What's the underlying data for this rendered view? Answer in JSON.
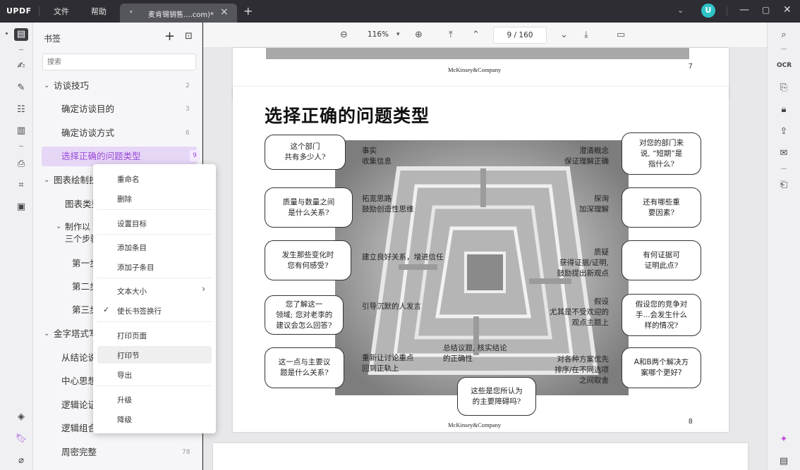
{
  "titlebar": {
    "logo": "UPDF",
    "menus": [
      "文件",
      "帮助"
    ],
    "tab_title": "麦肯锡销售....com)*",
    "tab_close": "×",
    "new_tab": "+",
    "avatar_letter": "U",
    "window_controls": [
      "—",
      "▢",
      "✕"
    ]
  },
  "panel": {
    "title": "书签",
    "search_placeholder": "搜索",
    "items": [
      {
        "label": "访谈技巧",
        "num": "2",
        "level": 0,
        "expanded": true
      },
      {
        "label": "确定访谈目的",
        "num": "3",
        "level": 1
      },
      {
        "label": "确定访谈方式",
        "num": "6",
        "level": 1
      },
      {
        "label": "选择正确的问题类型",
        "num": "9",
        "level": 1,
        "selected": true
      },
      {
        "label": "图表绘制技",
        "num": "",
        "level": 0,
        "expanded": true
      },
      {
        "label": "图表类型",
        "num": "",
        "level": 1
      },
      {
        "label": "制作以",
        "num": "",
        "level": 1,
        "expanded": true
      },
      {
        "label": "三个步骤",
        "num": "",
        "level": 1
      },
      {
        "label": "第一步",
        "num": "",
        "level": 2
      },
      {
        "label": "第二步",
        "num": "",
        "level": 2
      },
      {
        "label": "第三步",
        "num": "",
        "level": 2
      },
      {
        "label": "金字塔式写",
        "num": "",
        "level": 0,
        "expanded": true
      },
      {
        "label": "从结论说",
        "num": "",
        "level": 1
      },
      {
        "label": "中心思想",
        "num": "",
        "level": 1
      },
      {
        "label": "逻辑论证",
        "num": "",
        "level": 1
      },
      {
        "label": "逻辑组合",
        "num": "",
        "level": 1
      },
      {
        "label": "周密完整",
        "num": "78",
        "level": 1
      }
    ]
  },
  "context_menu": {
    "items": [
      "重命名",
      "删除",
      "设置目标",
      "添加条目",
      "添加子条目",
      "文本大小",
      "使长书签换行",
      "打印页面",
      "打印节",
      "导出",
      "升级",
      "降级"
    ]
  },
  "toolbar": {
    "zoom": "116%",
    "page_current": "9",
    "page_total": "160",
    "page_display": "9 / 160"
  },
  "pages": {
    "brand": "McKinsey&Company",
    "prev_num": "7",
    "cur_num": "8",
    "slide_title": "选择正确的问题类型",
    "bubbles_left": [
      "这个部门\n共有多少人?",
      "质量与数量之间\n是什么关系?",
      "发生那些变化时\n您有何感受?",
      "您了解这一\n领域; 您对老李的\n建议会怎么回答?",
      "这一点与主要议\n题是什么关系?"
    ],
    "texts_left": [
      "事实\n收集信息",
      "拓宽思路\n鼓励创造性思维",
      "建立良好关系，增进信任",
      "引导沉默的人发言",
      "重新让讨论重点\n回到正轨上"
    ],
    "bubbles_right": [
      "对您的部门来\n说, “短期”是\n指什么?",
      "还有哪些重\n要因素?",
      "有何证据可\n证明此点?",
      "假设您的竞争对\n手...会发生什么\n样的情况?",
      "A和B两个解决方\n案哪个更好?"
    ],
    "texts_right": [
      "澄清概念\n保证理解正确",
      "探询\n加深理解",
      "质疑\n获得证据/证明,\n鼓励提出新观点",
      "假设\n尤其是不受欢迎的\n观点主题上",
      "对各种方案优先\n排序/在不同选项\n之间取舍"
    ],
    "text_bottom": "总结议题, 核实结论\n的正确性",
    "bubble_bottom": "这些是您所认为\n的主要障碍吗?"
  },
  "icons": {
    "left_rail": [
      "reader-icon",
      "comment-icon",
      "edit-icon",
      "form-icon",
      "organize-icon",
      "ocr-icon",
      "crop-icon",
      "page-icon",
      "layers-icon",
      "bookmark-icon",
      "attachment-icon"
    ],
    "right_rail": [
      "search-icon",
      "ocr-icon",
      "convert-icon",
      "protect-icon",
      "share-icon",
      "email-icon",
      "save-icon",
      "ai-icon",
      "comment-icon"
    ]
  }
}
